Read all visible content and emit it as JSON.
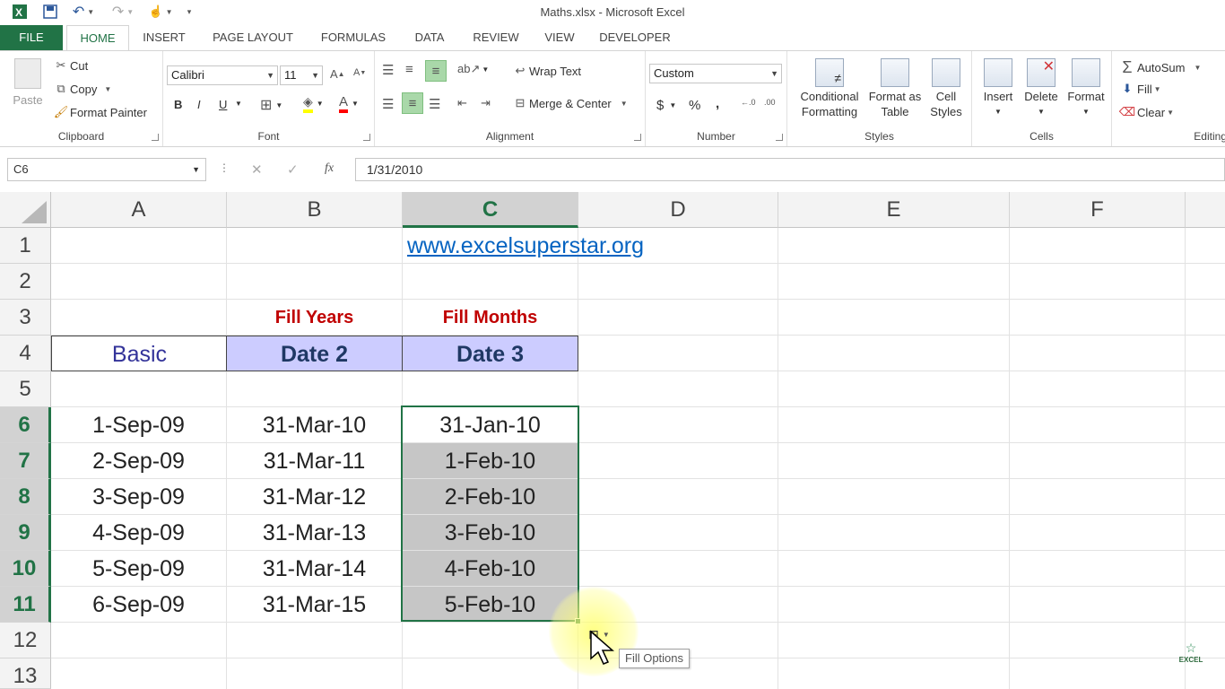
{
  "window": {
    "title": "Maths.xlsx - Microsoft Excel"
  },
  "qat": {
    "icons": [
      "excel-logo-icon",
      "save-icon",
      "undo-icon",
      "redo-icon",
      "touch-mode-icon",
      "customize-qat-icon"
    ]
  },
  "tabs": [
    "FILE",
    "HOME",
    "INSERT",
    "PAGE LAYOUT",
    "FORMULAS",
    "DATA",
    "REVIEW",
    "VIEW",
    "DEVELOPER"
  ],
  "ribbon": {
    "clipboard": {
      "label": "Clipboard",
      "paste": "Paste",
      "cut": "Cut",
      "copy": "Copy",
      "format_painter": "Format Painter"
    },
    "font": {
      "label": "Font",
      "name": "Calibri",
      "size": "11",
      "bold": "B",
      "italic": "I",
      "underline": "U"
    },
    "alignment": {
      "label": "Alignment",
      "wrap": "Wrap Text",
      "merge": "Merge & Center"
    },
    "number": {
      "label": "Number",
      "format": "Custom",
      "currency": "$",
      "percent": "%",
      "comma": ","
    },
    "styles": {
      "label": "Styles",
      "conditional_1": "Conditional",
      "conditional_2": "Formatting",
      "table_1": "Format as",
      "table_2": "Table",
      "cell_1": "Cell",
      "cell_2": "Styles"
    },
    "cells": {
      "label": "Cells",
      "insert": "Insert",
      "delete": "Delete",
      "format": "Format"
    },
    "editing": {
      "label": "Editing",
      "autosum": "AutoSum",
      "fill": "Fill",
      "clear": "Clear"
    }
  },
  "formula_bar": {
    "name_box": "C6",
    "formula": "1/31/2010",
    "fx": "fx"
  },
  "columns": [
    "A",
    "B",
    "C",
    "D",
    "E",
    "F"
  ],
  "rows": [
    "1",
    "2",
    "3",
    "4",
    "5",
    "6",
    "7",
    "8",
    "9",
    "10",
    "11",
    "12",
    "13"
  ],
  "cells": {
    "c1": "www.excelsuperstar.org",
    "b3": "Fill Years",
    "c3": "Fill Months",
    "a4": "Basic",
    "b4": "Date 2",
    "c4": "Date 3",
    "a": [
      "1-Sep-09",
      "2-Sep-09",
      "3-Sep-09",
      "4-Sep-09",
      "5-Sep-09",
      "6-Sep-09"
    ],
    "b": [
      "31-Mar-10",
      "31-Mar-11",
      "31-Mar-12",
      "31-Mar-13",
      "31-Mar-14",
      "31-Mar-15"
    ],
    "c": [
      "31-Jan-10",
      "1-Feb-10",
      "2-Feb-10",
      "3-Feb-10",
      "4-Feb-10",
      "5-Feb-10"
    ]
  },
  "tooltip": {
    "text": "Fill Options"
  },
  "watermark": {
    "text": "EXCEL"
  }
}
